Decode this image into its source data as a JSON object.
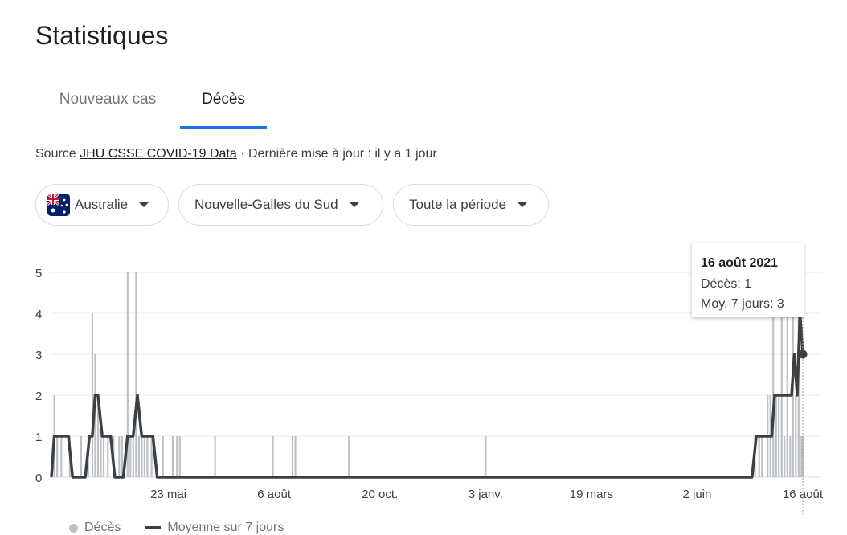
{
  "page": {
    "title": "Statistiques"
  },
  "tabs": [
    {
      "label": "Nouveaux cas",
      "active": false
    },
    {
      "label": "Décès",
      "active": true
    }
  ],
  "source": {
    "prefix": "Source",
    "link": "JHU CSSE COVID-19 Data",
    "suffix": " · Dernière mise à jour : il y a 1 jour"
  },
  "filters": {
    "country": "Australie",
    "region": "Nouvelle-Galles du Sud",
    "period": "Toute la période"
  },
  "colors": {
    "accent": "#1a73e8",
    "bars": "#bdc1c6",
    "line": "#3c4043"
  },
  "tooltip": {
    "date": "16 août 2021",
    "deaths": "Décès: 1",
    "avg": "Moy. 7 jours: 3"
  },
  "legend": {
    "deaths": "Décès",
    "average": "Moyenne sur 7 jours"
  },
  "chart_data": {
    "type": "bar",
    "title": "",
    "ylim": [
      0,
      5
    ],
    "yticks": [
      0,
      1,
      2,
      3,
      4,
      5
    ],
    "xlim": [
      "2020-03-01",
      "2021-08-16"
    ],
    "xticks": [
      {
        "date": "2020-05-23",
        "label": "23 mai"
      },
      {
        "date": "2020-08-06",
        "label": "6 août"
      },
      {
        "date": "2020-10-20",
        "label": "20 oct."
      },
      {
        "date": "2021-01-03",
        "label": "3 janv."
      },
      {
        "date": "2021-03-19",
        "label": "19 mars"
      },
      {
        "date": "2021-06-02",
        "label": "2 juin"
      },
      {
        "date": "2021-08-16",
        "label": "16 août"
      }
    ],
    "series": [
      {
        "name": "Décès",
        "type": "bar",
        "points": [
          [
            "2020-03-03",
            2
          ],
          [
            "2020-03-05",
            1
          ],
          [
            "2020-03-08",
            1
          ],
          [
            "2020-03-14",
            1
          ],
          [
            "2020-03-22",
            1
          ],
          [
            "2020-03-27",
            1
          ],
          [
            "2020-03-30",
            4
          ],
          [
            "2020-04-01",
            3
          ],
          [
            "2020-04-03",
            2
          ],
          [
            "2020-04-05",
            1
          ],
          [
            "2020-04-07",
            1
          ],
          [
            "2020-04-10",
            1
          ],
          [
            "2020-04-14",
            1
          ],
          [
            "2020-04-18",
            1
          ],
          [
            "2020-04-20",
            1
          ],
          [
            "2020-04-24",
            5
          ],
          [
            "2020-04-26",
            1
          ],
          [
            "2020-04-28",
            1
          ],
          [
            "2020-04-30",
            5
          ],
          [
            "2020-05-02",
            1
          ],
          [
            "2020-05-04",
            1
          ],
          [
            "2020-05-06",
            1
          ],
          [
            "2020-05-08",
            1
          ],
          [
            "2020-05-11",
            1
          ],
          [
            "2020-05-19",
            1
          ],
          [
            "2020-05-26",
            1
          ],
          [
            "2020-05-29",
            1
          ],
          [
            "2020-05-31",
            1
          ],
          [
            "2020-06-25",
            1
          ],
          [
            "2020-08-05",
            1
          ],
          [
            "2020-08-19",
            1
          ],
          [
            "2020-08-21",
            1
          ],
          [
            "2020-09-28",
            1
          ],
          [
            "2021-01-03",
            1
          ],
          [
            "2021-07-13",
            1
          ],
          [
            "2021-07-16",
            1
          ],
          [
            "2021-07-18",
            1
          ],
          [
            "2021-07-22",
            2
          ],
          [
            "2021-07-24",
            2
          ],
          [
            "2021-07-26",
            4
          ],
          [
            "2021-07-28",
            2
          ],
          [
            "2021-07-30",
            2
          ],
          [
            "2021-08-01",
            4
          ],
          [
            "2021-08-03",
            1
          ],
          [
            "2021-08-05",
            4
          ],
          [
            "2021-08-07",
            1
          ],
          [
            "2021-08-09",
            4
          ],
          [
            "2021-08-11",
            2
          ],
          [
            "2021-08-13",
            4
          ],
          [
            "2021-08-15",
            1
          ],
          [
            "2021-08-16",
            1
          ]
        ]
      },
      {
        "name": "Moyenne sur 7 jours",
        "type": "line",
        "points": [
          [
            "2020-03-01",
            0
          ],
          [
            "2020-03-03",
            1
          ],
          [
            "2020-03-13",
            1
          ],
          [
            "2020-03-16",
            0
          ],
          [
            "2020-03-25",
            0
          ],
          [
            "2020-03-28",
            1
          ],
          [
            "2020-03-30",
            1
          ],
          [
            "2020-04-01",
            2
          ],
          [
            "2020-04-03",
            2
          ],
          [
            "2020-04-06",
            1
          ],
          [
            "2020-04-12",
            1
          ],
          [
            "2020-04-15",
            0
          ],
          [
            "2020-04-21",
            0
          ],
          [
            "2020-04-24",
            1
          ],
          [
            "2020-04-28",
            1
          ],
          [
            "2020-05-01",
            2
          ],
          [
            "2020-05-04",
            1
          ],
          [
            "2020-05-12",
            1
          ],
          [
            "2020-05-15",
            0
          ],
          [
            "2021-07-11",
            0
          ],
          [
            "2021-07-14",
            1
          ],
          [
            "2021-07-25",
            1
          ],
          [
            "2021-07-27",
            2
          ],
          [
            "2021-08-08",
            2
          ],
          [
            "2021-08-10",
            3
          ],
          [
            "2021-08-12",
            2
          ],
          [
            "2021-08-14",
            4
          ],
          [
            "2021-08-16",
            3
          ]
        ]
      }
    ]
  }
}
